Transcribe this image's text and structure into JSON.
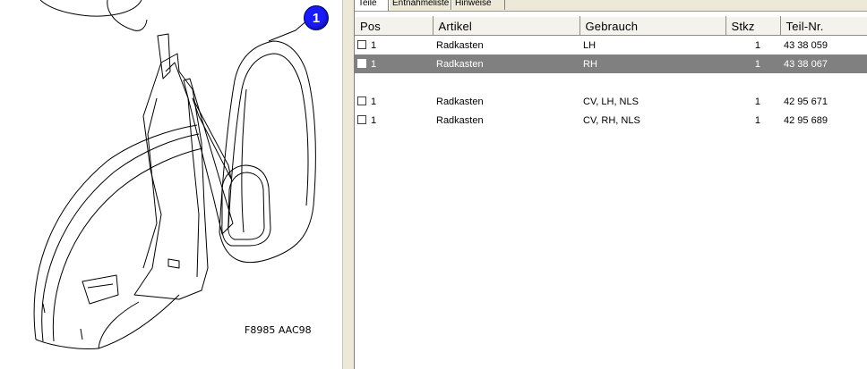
{
  "drawing": {
    "callout_number": "1",
    "drawing_code": "F8985 AAC98"
  },
  "tabs": [
    {
      "label": "Teile",
      "active": true
    },
    {
      "label": "Entnahmeliste",
      "active": false
    },
    {
      "label": "Hinweise",
      "active": false
    }
  ],
  "table": {
    "columns": [
      "Pos",
      "Artikel",
      "Gebrauch",
      "Stkz",
      "Teil-Nr."
    ],
    "rows": [
      {
        "checked": false,
        "selected": false,
        "pos": "1",
        "artikel": "Radkasten",
        "gebrauch": "LH",
        "stkz": "1",
        "teil_nr": "43 38 059"
      },
      {
        "checked": false,
        "selected": true,
        "pos": "1",
        "artikel": "Radkasten",
        "gebrauch": "RH",
        "stkz": "1",
        "teil_nr": "43 38 067"
      },
      {
        "empty": true
      },
      {
        "checked": false,
        "selected": false,
        "pos": "1",
        "artikel": "Radkasten",
        "gebrauch": "CV, LH, NLS",
        "stkz": "1",
        "teil_nr": "42 95 671"
      },
      {
        "checked": false,
        "selected": false,
        "pos": "1",
        "artikel": "Radkasten",
        "gebrauch": "CV, RH, NLS",
        "stkz": "1",
        "teil_nr": "42 95 689"
      }
    ]
  },
  "colors": {
    "callout_blue": "#1a1aff",
    "selection_gray": "#808080",
    "chrome": "#ece9d8"
  }
}
